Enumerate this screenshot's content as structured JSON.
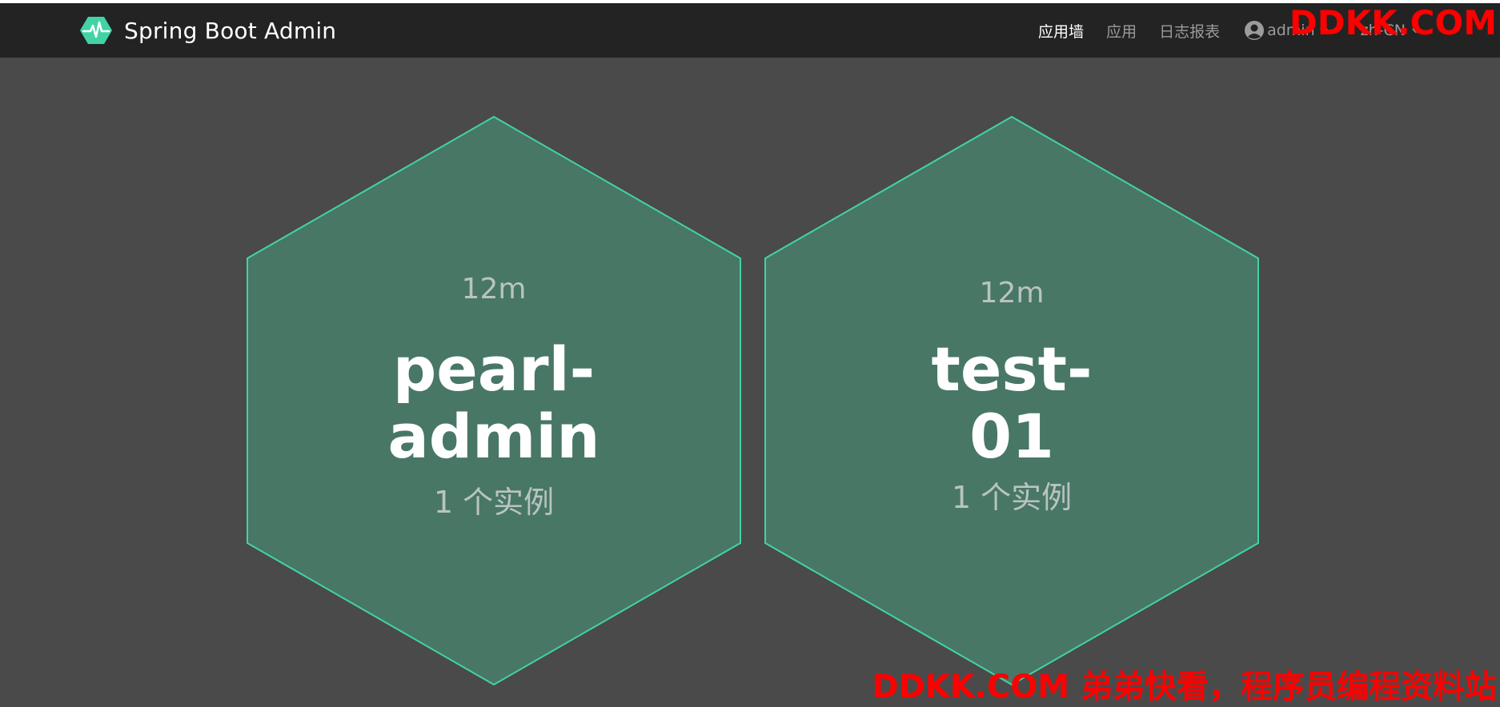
{
  "navbar": {
    "brand": "Spring Boot Admin",
    "tabs": [
      {
        "label": "应用墙"
      },
      {
        "label": "应用"
      },
      {
        "label": "日志报表"
      }
    ],
    "user": "admin",
    "lang": "zh-CN"
  },
  "watermarks": {
    "top": "DDKK.COM",
    "bottom": "DDKK.COM 弟弟快看，程序员编程资料站"
  },
  "applications": [
    {
      "uptime": "12m",
      "name_line1": "pearl-",
      "name_line2": "admin",
      "instances": "1 个实例"
    },
    {
      "uptime": "12m",
      "name_line1": "test-",
      "name_line2": "01",
      "instances": "1 个实例"
    }
  ],
  "colors": {
    "navbar_bg": "#232323",
    "page_bg": "#4a4a4a",
    "hex_fill": "#487766",
    "hex_border": "#42d3a5",
    "brand_icon": "#42d3a5",
    "watermark": "#ff0000"
  }
}
